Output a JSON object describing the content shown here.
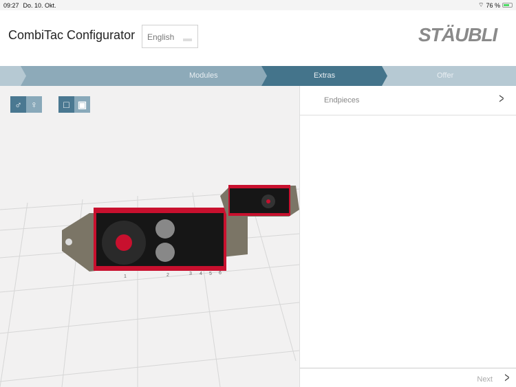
{
  "status": {
    "time": "09:27",
    "date": "Do. 10. Okt.",
    "battery": "76 %",
    "battery_level": 0.76
  },
  "header": {
    "title": "CombiTac Configurator",
    "language": "English",
    "logo": "STÄUBLI"
  },
  "steps": [
    {
      "label": "Modules",
      "state": "done"
    },
    {
      "label": "Extras",
      "state": "active"
    },
    {
      "label": "Offer",
      "state": "pending"
    }
  ],
  "viewer": {
    "gender_toggle": [
      "male-icon",
      "female-icon"
    ],
    "view_toggle": [
      "single-view-icon",
      "split-view-icon"
    ],
    "module_labels": [
      "1",
      "2",
      "3",
      "4",
      "5",
      "6"
    ]
  },
  "panel": {
    "items": [
      {
        "label": "Endpieces"
      }
    ],
    "next_label": "Next"
  },
  "colors": {
    "active_step": "#44748b",
    "done_step": "#8daab9",
    "pending_step": "#b6c9d3",
    "accent_red": "#c8102e"
  }
}
